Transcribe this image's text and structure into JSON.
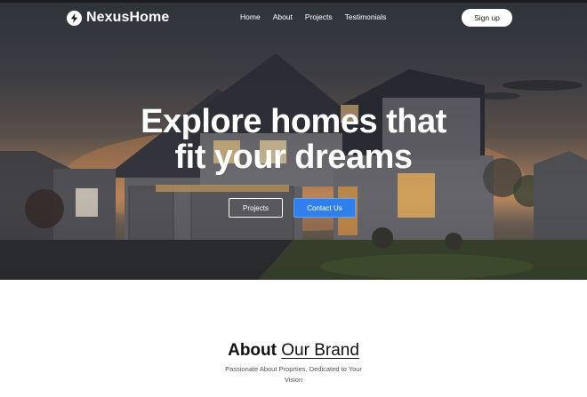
{
  "brand": {
    "name": "NexusHome",
    "icon": "lightning-bolt-icon"
  },
  "nav": {
    "links": [
      "Home",
      "About",
      "Projects",
      "Testimonials"
    ],
    "signup_label": "Sign up"
  },
  "hero": {
    "title_line1": "Explore homes that",
    "title_line2": "fit your dreams",
    "projects_label": "Projects",
    "contact_label": "Contact Us"
  },
  "about": {
    "title_bold": "About",
    "title_light": "Our Brand",
    "subtitle": "Passionate About Proprties, Dedicated to Your Vision"
  },
  "colors": {
    "accent": "#2f80ed",
    "text_dark": "#111111",
    "nav_text": "#ffffff"
  }
}
